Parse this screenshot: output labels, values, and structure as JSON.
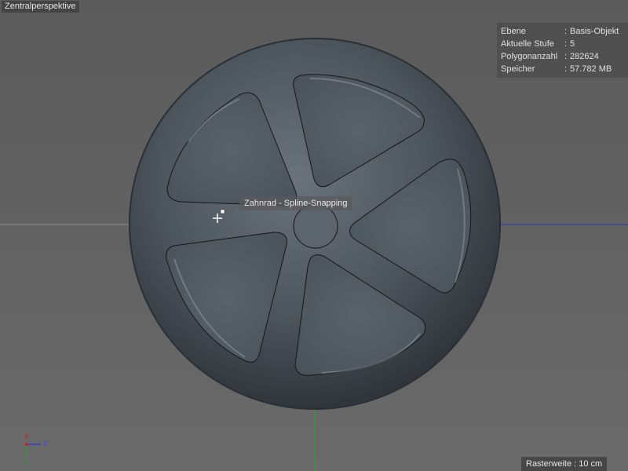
{
  "viewport": {
    "label": "Zentralperspektive",
    "hud": [
      {
        "key": "Ebene",
        "value": "Basis-Objekt"
      },
      {
        "key": "Aktuelle Stufe",
        "value": "5"
      },
      {
        "key": "Polygonanzahl",
        "value": "282624"
      },
      {
        "key": "Speicher",
        "value": "57.782 MB"
      }
    ],
    "snap_tooltip": "Zahnrad - Spline-Snapping",
    "grid_spacing": "Rasterweite : 10 cm",
    "axes": {
      "x": "X",
      "y": "Y",
      "z": "Z"
    }
  },
  "colors": {
    "background": "#5f5f5f",
    "wheel": "#4a525a",
    "x_axis": "#3a3ad0",
    "y_axis": "#2aa02a",
    "axis_red": "#d02020"
  }
}
